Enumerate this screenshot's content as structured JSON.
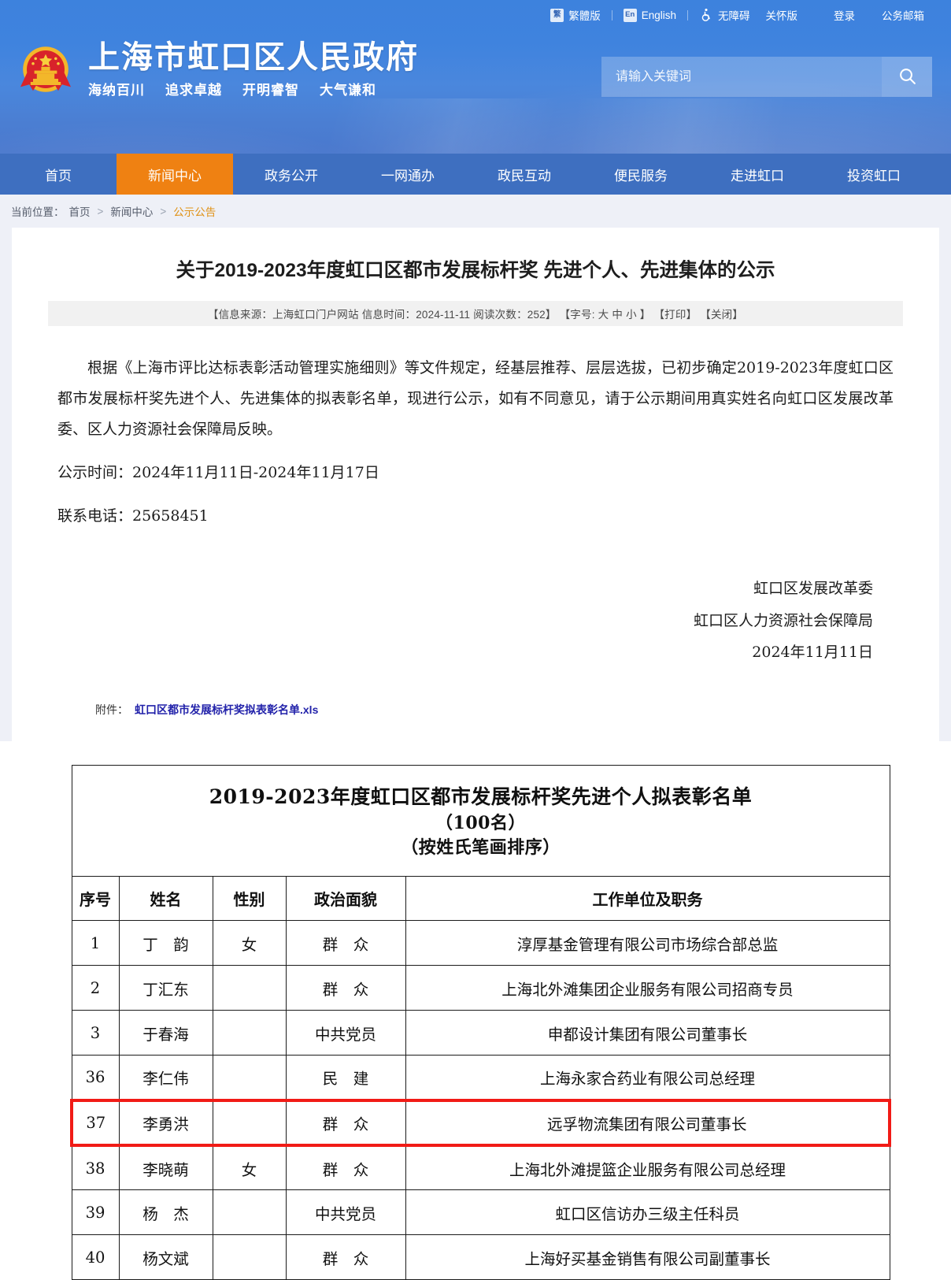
{
  "topbar": {
    "traditional": {
      "badge": "繁",
      "label": "繁體版"
    },
    "english": {
      "badge": "En",
      "label": "English"
    },
    "accessibility": {
      "label": "无障碍"
    },
    "care_version": {
      "label": "关怀版"
    },
    "login": "登录",
    "mail": "公务邮箱"
  },
  "brand": {
    "title": "上海市虹口区人民政府",
    "motto": [
      "海纳百川",
      "追求卓越",
      "开明睿智",
      "大气谦和"
    ]
  },
  "search": {
    "placeholder": "请输入关键词",
    "value": "",
    "button_icon": "search-icon"
  },
  "nav": {
    "items": [
      {
        "label": "首页",
        "active": false
      },
      {
        "label": "新闻中心",
        "active": true
      },
      {
        "label": "政务公开",
        "active": false
      },
      {
        "label": "一网通办",
        "active": false
      },
      {
        "label": "政民互动",
        "active": false
      },
      {
        "label": "便民服务",
        "active": false
      },
      {
        "label": "走进虹口",
        "active": false
      },
      {
        "label": "投资虹口",
        "active": false
      }
    ],
    "active_color": "#ef8112",
    "bar_color": "#3e6fc0"
  },
  "breadcrumb": {
    "prefix": "当前位置：",
    "item1": "首页",
    "sep": ">",
    "item2": "新闻中心",
    "current": "公示公告",
    "current_color": "#e09217"
  },
  "article": {
    "title": "关于2019-2023年度虹口区都市发展标杆奖 先进个人、先进集体的公示",
    "meta": {
      "source_label": "【信息来源：上海虹口门户网站",
      "time_label": "信息时间：2024-11-11",
      "views_label": "阅读次数：252】",
      "fontsize_label": "【字号:",
      "fontsize_large": "大",
      "fontsize_medium": "中",
      "fontsize_small": "小",
      "fontsize_close": "】",
      "print": "【打印】",
      "close": "【关闭】"
    },
    "paragraphs": [
      "根据《上海市评比达标表彰活动管理实施细则》等文件规定，经基层推荐、层层选拔，已初步确定2019-2023年度虹口区都市发展标杆奖先进个人、先进集体的拟表彰名单，现进行公示，如有不同意见，请于公示期间用真实姓名向虹口区发展改革委、区人力资源社会保障局反映。",
      "公示时间：2024年11月11日-2024年11月17日",
      "联系电话：25658451"
    ],
    "signature": [
      "虹口区发展改革委",
      "虹口区人力资源社会保障局",
      "2024年11月11日"
    ],
    "attachment": {
      "label": "附件：",
      "file_name": "虹口区都市发展标杆奖拟表彰名单.xls"
    }
  },
  "roster": {
    "title_line1": "2019-2023年度虹口区都市发展标杆奖先进个人拟表彰名单",
    "title_line2": "（100名）",
    "title_line3": "（按姓氏笔画排序）",
    "headers": [
      "序号",
      "姓名",
      "性别",
      "政治面貌",
      "工作单位及职务"
    ],
    "highlight_color": "#f11b16",
    "rows": [
      {
        "no": "1",
        "name": "丁　韵",
        "sex": "女",
        "politics": "群　众",
        "unit": "淳厚基金管理有限公司市场综合部总监",
        "highlight": false
      },
      {
        "no": "2",
        "name": "丁汇东",
        "sex": "",
        "politics": "群　众",
        "unit": "上海北外滩集团企业服务有限公司招商专员",
        "highlight": false
      },
      {
        "no": "3",
        "name": "于春海",
        "sex": "",
        "politics": "中共党员",
        "unit": "申都设计集团有限公司董事长",
        "highlight": false
      },
      {
        "no": "36",
        "name": "李仁伟",
        "sex": "",
        "politics": "民　建",
        "unit": "上海永家合药业有限公司总经理",
        "highlight": false
      },
      {
        "no": "37",
        "name": "李勇洪",
        "sex": "",
        "politics": "群　众",
        "unit": "远孚物流集团有限公司董事长",
        "highlight": true
      },
      {
        "no": "38",
        "name": "李晓萌",
        "sex": "女",
        "politics": "群　众",
        "unit": "上海北外滩提篮企业服务有限公司总经理",
        "highlight": false
      },
      {
        "no": "39",
        "name": "杨　杰",
        "sex": "",
        "politics": "中共党员",
        "unit": "虹口区信访办三级主任科员",
        "highlight": false
      },
      {
        "no": "40",
        "name": "杨文斌",
        "sex": "",
        "politics": "群　众",
        "unit": "上海好买基金销售有限公司副董事长",
        "highlight": false
      }
    ]
  }
}
